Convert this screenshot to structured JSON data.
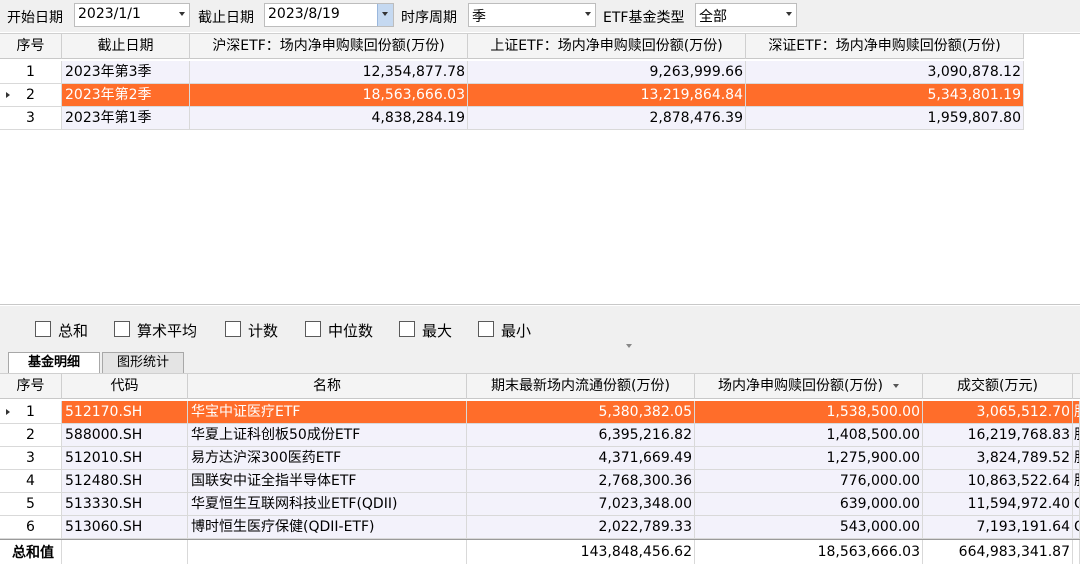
{
  "filters": {
    "start_label": "开始日期",
    "start_value": "2023/1/1",
    "end_label": "截止日期",
    "end_value": "2023/8/19",
    "period_label": "时序周期",
    "period_value": "季",
    "type_label": "ETF基金类型",
    "type_value": "全部"
  },
  "summary_table": {
    "headers": [
      "序号",
      "截止日期",
      "沪深ETF：场内净申购赎回份额(万份)",
      "上证ETF：场内净申购赎回份额(万份)",
      "深证ETF：场内净申购赎回份额(万份)"
    ],
    "rows": [
      {
        "idx": "1",
        "date": "2023年第3季",
        "hs": "12,354,877.78",
        "sh": "9,263,999.66",
        "sz": "3,090,878.12"
      },
      {
        "idx": "2",
        "date": "2023年第2季",
        "hs": "18,563,666.03",
        "sh": "13,219,864.84",
        "sz": "5,343,801.19"
      },
      {
        "idx": "3",
        "date": "2023年第1季",
        "hs": "4,838,284.19",
        "sh": "2,878,476.39",
        "sz": "1,959,807.80"
      }
    ]
  },
  "aggregates": [
    "总和",
    "算术平均",
    "计数",
    "中位数",
    "最大",
    "最小"
  ],
  "tabs": [
    "基金明细",
    "图形统计"
  ],
  "detail_table": {
    "headers": [
      "序号",
      "代码",
      "名称",
      "期末最新场内流通份额(万份)",
      "场内净申购赎回份额(万份)",
      "成交额(万元)"
    ],
    "rows": [
      {
        "idx": "1",
        "code": "512170.SH",
        "name": "华宝中证医疗ETF",
        "shares": "5,380,382.05",
        "net": "1,538,500.00",
        "turnover": "3,065,512.70",
        "extra": "服"
      },
      {
        "idx": "2",
        "code": "588000.SH",
        "name": "华夏上证科创板50成份ETF",
        "shares": "6,395,216.82",
        "net": "1,408,500.00",
        "turnover": "16,219,768.83",
        "extra": "服"
      },
      {
        "idx": "3",
        "code": "512010.SH",
        "name": "易方达沪深300医药ETF",
        "shares": "4,371,669.49",
        "net": "1,275,900.00",
        "turnover": "3,824,789.52",
        "extra": "服"
      },
      {
        "idx": "4",
        "code": "512480.SH",
        "name": "国联安中证全指半导体ETF",
        "shares": "2,768,300.36",
        "net": "776,000.00",
        "turnover": "10,863,522.64",
        "extra": "服"
      },
      {
        "idx": "5",
        "code": "513330.SH",
        "name": "华夏恒生互联网科技业ETF(QDII)",
        "shares": "7,023,348.00",
        "net": "639,000.00",
        "turnover": "11,594,972.40",
        "extra": "Q"
      },
      {
        "idx": "6",
        "code": "513060.SH",
        "name": "博时恒生医疗保健(QDII-ETF)",
        "shares": "2,022,789.33",
        "net": "543,000.00",
        "turnover": "7,193,191.64",
        "extra": "Q"
      }
    ],
    "total": {
      "label": "总和值",
      "shares": "143,848,456.62",
      "net": "18,563,666.03",
      "turnover": "664,983,341.87"
    }
  },
  "colors": {
    "selected_row": "#ff6d2a",
    "cell_bg": "#f3f2fb",
    "header_bg": "#f4f4f4",
    "toolbar_bg": "#f0f0f0"
  }
}
